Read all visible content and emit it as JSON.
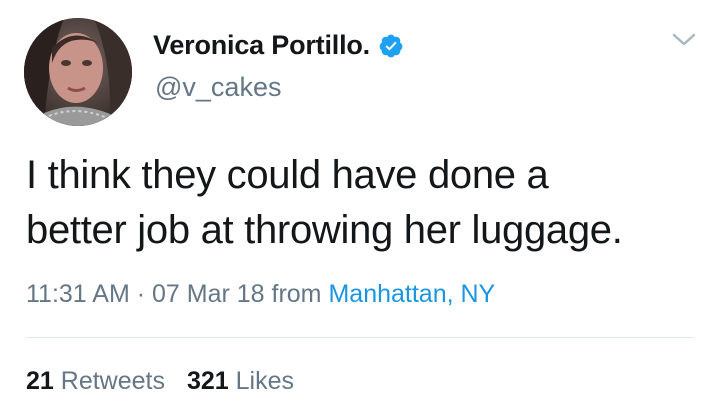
{
  "user": {
    "display_name": "Veronica Portillo.",
    "handle": "@v_cakes",
    "verified": true,
    "avatar_icon": "profile-photo"
  },
  "tweet": {
    "text_line1": "I think they could have done a",
    "text_line2": "better job at throwing her luggage."
  },
  "meta": {
    "time": "11:31 AM",
    "separator": " · ",
    "date": "07 Mar 18",
    "from_label": " from ",
    "location": "Manhattan, NY"
  },
  "stats": {
    "retweets_count": "21",
    "retweets_label": "Retweets",
    "likes_count": "321",
    "likes_label": "Likes"
  },
  "colors": {
    "text": "#14171a",
    "secondary": "#657786",
    "link": "#1b95e0",
    "verified": "#1da1f2",
    "divider": "#e1e8ed"
  }
}
